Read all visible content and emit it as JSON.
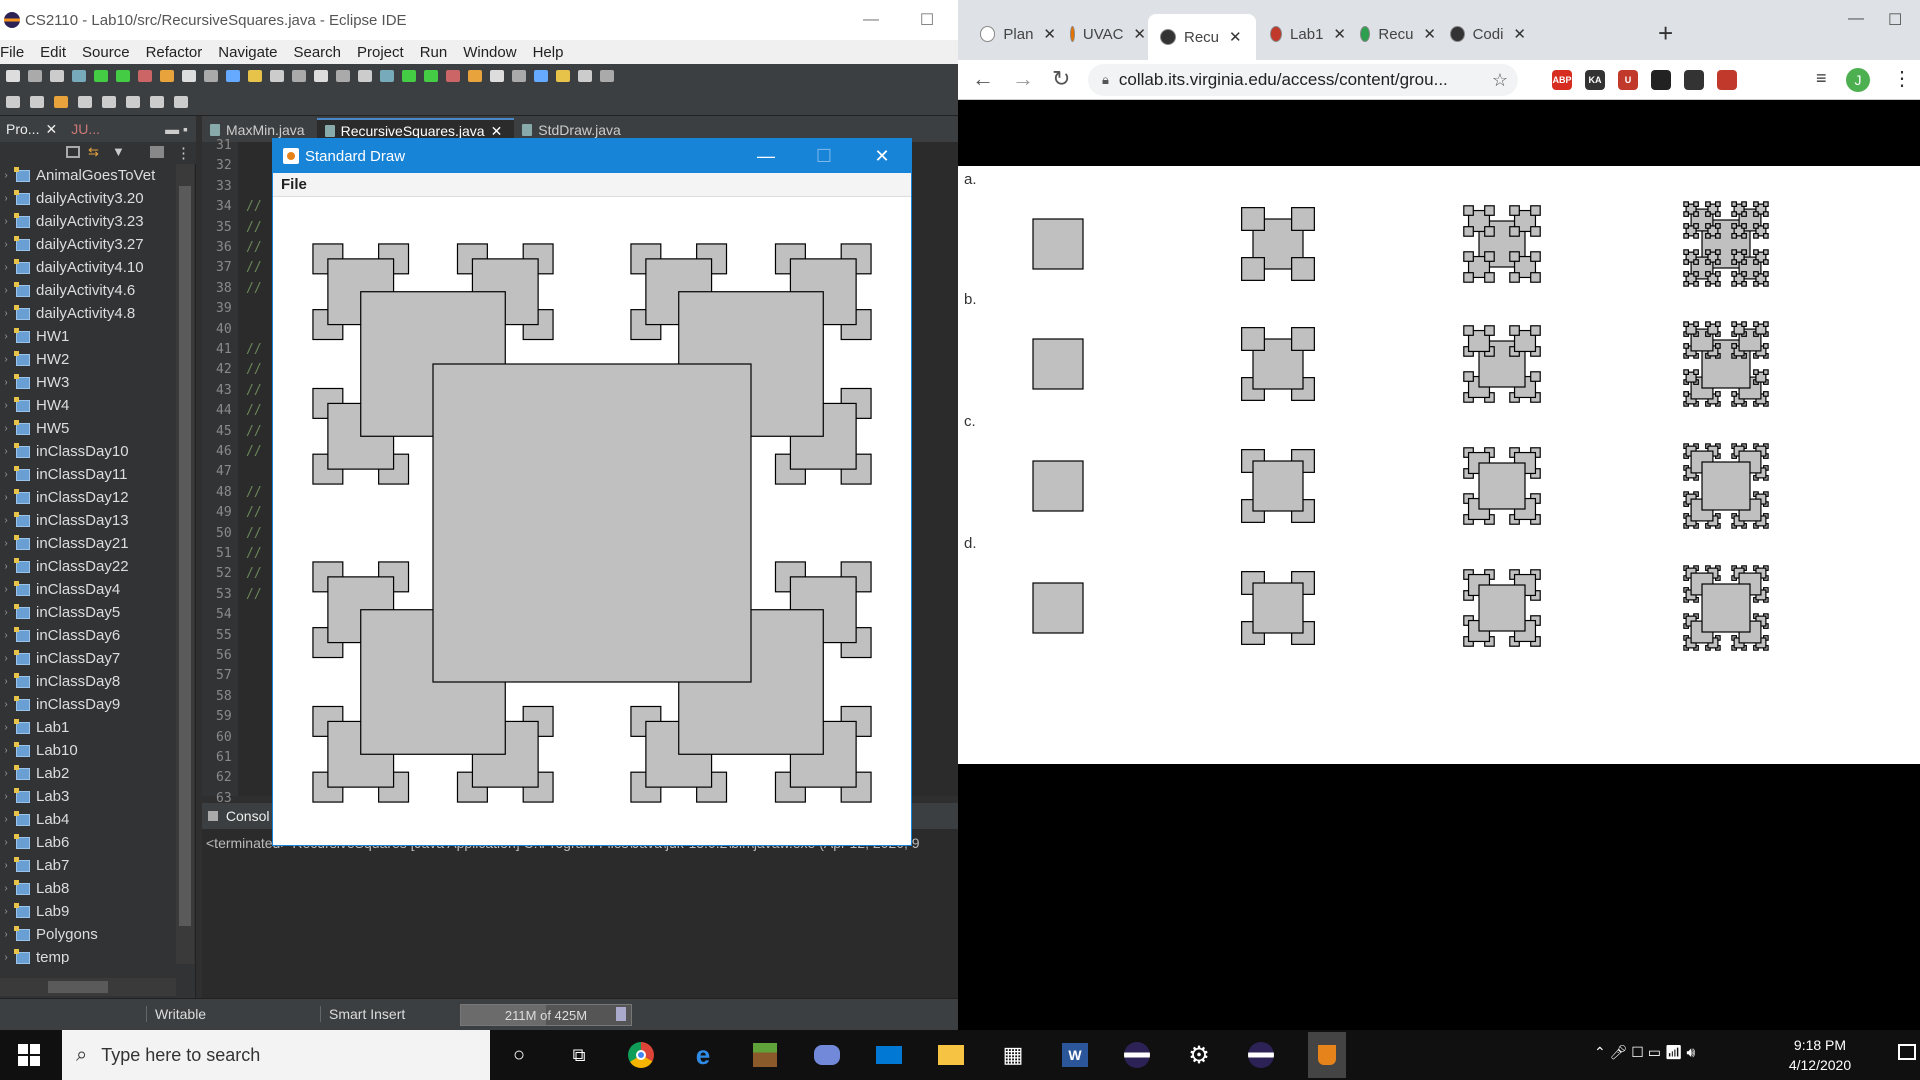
{
  "eclipse": {
    "title": "CS2110 - Lab10/src/RecursiveSquares.java - Eclipse IDE",
    "menu": [
      "File",
      "Edit",
      "Source",
      "Refactor",
      "Navigate",
      "Search",
      "Project",
      "Run",
      "Window",
      "Help"
    ],
    "explorer_tabs": [
      "Pro...",
      "JU..."
    ],
    "projects": [
      "AnimalGoesToVet",
      "dailyActivity3.20",
      "dailyActivity3.23",
      "dailyActivity3.27",
      "dailyActivity4.10",
      "dailyActivity4.6",
      "dailyActivity4.8",
      "HW1",
      "HW2",
      "HW3",
      "HW4",
      "HW5",
      "inClassDay10",
      "inClassDay11",
      "inClassDay12",
      "inClassDay13",
      "inClassDay21",
      "inClassDay22",
      "inClassDay4",
      "inClassDay5",
      "inClassDay6",
      "inClassDay7",
      "inClassDay8",
      "inClassDay9",
      "Lab1",
      "Lab10",
      "Lab2",
      "Lab3",
      "Lab4",
      "Lab6",
      "Lab7",
      "Lab8",
      "Lab9",
      "Polygons",
      "temp"
    ],
    "editor_tabs": [
      "MaxMin.java",
      "RecursiveSquares.java",
      "StdDraw.java"
    ],
    "line_numbers": [
      "31",
      "32",
      "33",
      "34",
      "35",
      "36",
      "37",
      "38",
      "39",
      "40",
      "41",
      "42",
      "43",
      "44",
      "45",
      "46",
      "47",
      "48",
      "49",
      "50",
      "51",
      "52",
      "53",
      "54",
      "55",
      "56",
      "57",
      "58",
      "59",
      "60",
      "61",
      "62",
      "63"
    ],
    "comment_marker": "//",
    "console_tab": "Consol",
    "console_line": "<terminated> RecursiveSquares [Java Application] C:\\Program Files\\Java\\jdk-13.0.2\\bin\\javaw.exe (Apr 12, 2020, 9",
    "status": {
      "writable": "Writable",
      "insert": "Smart Insert",
      "heap": "211M of 425M",
      "heap_used_fraction": 0.5
    }
  },
  "stddraw": {
    "title": "Standard Draw",
    "menu": "File"
  },
  "chrome": {
    "tabs": [
      {
        "label": "Plan",
        "fav": "#ffffff",
        "icon": "p-icon"
      },
      {
        "label": "UVAC",
        "fav": "#e57200",
        "icon": "uva-icon"
      },
      {
        "label": "Recu",
        "fav": "#333333",
        "icon": "globe-icon",
        "active": true
      },
      {
        "label": "Lab1",
        "fav": "#c0392b",
        "icon": "clapper-icon"
      },
      {
        "label": "Recu",
        "fav": "#2e9e4f",
        "icon": "gg-icon"
      },
      {
        "label": "Codi",
        "fav": "#333333",
        "icon": "globe-icon"
      }
    ],
    "url": "collab.its.virginia.edu/access/content/grou...",
    "profile_initial": "J",
    "extensions": [
      {
        "label": "ABP",
        "color": "#d62d20"
      },
      {
        "label": "KA",
        "color": "#333333"
      },
      {
        "label": "U",
        "color": "#c0392b"
      },
      {
        "label": "",
        "color": "#222222"
      },
      {
        "label": "",
        "color": "#333333"
      },
      {
        "label": "",
        "color": "#c0392b"
      }
    ],
    "options": [
      "a.",
      "b.",
      "c.",
      "d."
    ]
  },
  "taskbar": {
    "search_placeholder": "Type here to search",
    "time": "9:18 PM",
    "date": "4/12/2020"
  }
}
